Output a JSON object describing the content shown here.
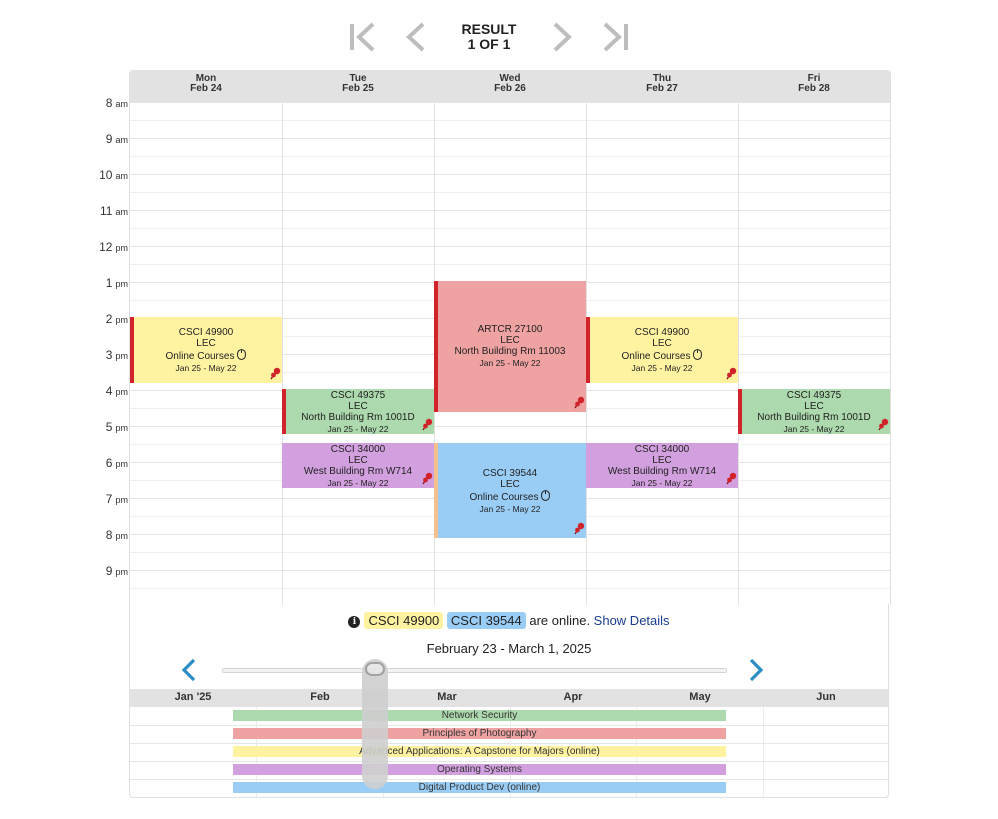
{
  "nav": {
    "result_label": "RESULT",
    "result_count": "1 OF 1",
    "first_icon": "first-page-icon",
    "prev_icon": "chevron-left-icon",
    "next_icon": "chevron-right-icon",
    "last_icon": "last-page-icon"
  },
  "calendar": {
    "days": [
      {
        "dow": "Mon",
        "date": "Feb 24"
      },
      {
        "dow": "Tue",
        "date": "Feb 25"
      },
      {
        "dow": "Wed",
        "date": "Feb 26"
      },
      {
        "dow": "Thu",
        "date": "Feb 27"
      },
      {
        "dow": "Fri",
        "date": "Feb 28"
      }
    ],
    "hours": [
      {
        "num": "8",
        "ampm": "am"
      },
      {
        "num": "9",
        "ampm": "am"
      },
      {
        "num": "10",
        "ampm": "am"
      },
      {
        "num": "11",
        "ampm": "am"
      },
      {
        "num": "12",
        "ampm": "pm"
      },
      {
        "num": "1",
        "ampm": "pm"
      },
      {
        "num": "2",
        "ampm": "pm"
      },
      {
        "num": "3",
        "ampm": "pm"
      },
      {
        "num": "4",
        "ampm": "pm"
      },
      {
        "num": "5",
        "ampm": "pm"
      },
      {
        "num": "6",
        "ampm": "pm"
      },
      {
        "num": "7",
        "ampm": "pm"
      },
      {
        "num": "8",
        "ampm": "pm"
      },
      {
        "num": "9",
        "ampm": "pm"
      }
    ],
    "events": {
      "mon_49900": {
        "course": "CSCI 49900",
        "type": "LEC",
        "location": "Online Courses",
        "dates": "Jan 25 - May 22"
      },
      "tue_49375": {
        "course": "CSCI 49375",
        "type": "LEC",
        "location": "North Building Rm 1001D",
        "dates": "Jan 25 - May 22"
      },
      "tue_34000": {
        "course": "CSCI 34000",
        "type": "LEC",
        "location": "West Building Rm W714",
        "dates": "Jan 25 - May 22"
      },
      "wed_27100": {
        "course": "ARTCR 27100",
        "type": "LEC",
        "location": "North Building Rm 11003",
        "dates": "Jan 25 - May 22"
      },
      "wed_39544": {
        "course": "CSCI 39544",
        "type": "LEC",
        "location": "Online Courses",
        "dates": "Jan 25 - May 22"
      },
      "thu_49900": {
        "course": "CSCI 49900",
        "type": "LEC",
        "location": "Online Courses",
        "dates": "Jan 25 - May 22"
      },
      "thu_34000": {
        "course": "CSCI 34000",
        "type": "LEC",
        "location": "West Building Rm W714",
        "dates": "Jan 25 - May 22"
      },
      "fri_49375": {
        "course": "CSCI 49375",
        "type": "LEC",
        "location": "North Building Rm 1001D",
        "dates": "Jan 25 - May 22"
      }
    }
  },
  "online": {
    "tag1": "CSCI 49900",
    "tag2": "CSCI 39544",
    "suffix": " are online. ",
    "show_details": "Show Details"
  },
  "week_range": "February 23 - March 1, 2025",
  "gantt": {
    "months": [
      "Jan '25",
      "Feb",
      "Mar",
      "Apr",
      "May",
      "Jun"
    ],
    "bars": [
      "Network Security",
      "Principles of Photography",
      "Advanced Applications: A Capstone for Majors (online)",
      "Operating Systems",
      "Digital Product Dev (online)"
    ]
  },
  "colors": {
    "green": "#acd9ad",
    "red": "#efa2a2",
    "yellow": "#fff3a2",
    "purple": "#d3a0df",
    "blue": "#9acdf6",
    "stripe_red": "#d0232a",
    "stripe_orange": "#f4c08c",
    "arrow_blue": "#2c8cc4"
  }
}
